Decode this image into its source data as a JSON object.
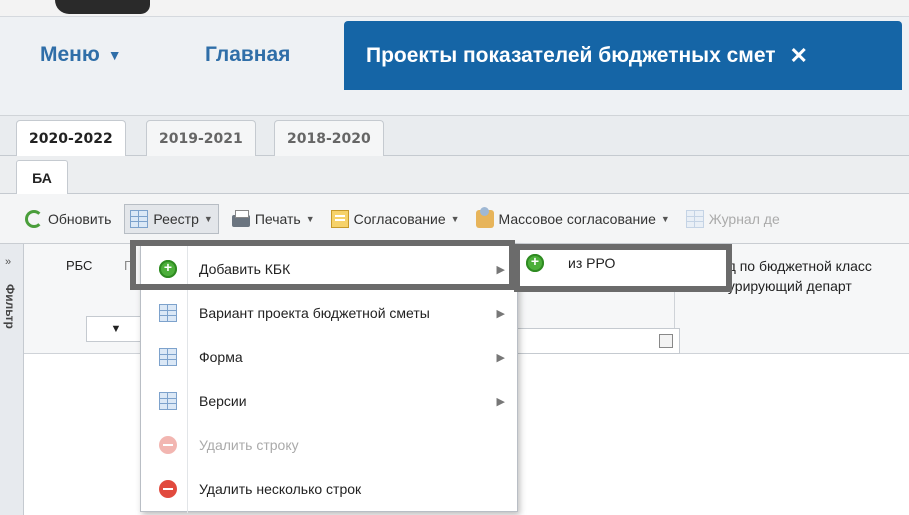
{
  "nav": {
    "menu_label": "Меню",
    "home_label": "Главная",
    "active_tab_title": "Проекты показателей бюджетных смет"
  },
  "year_tabs": [
    "2020-2022",
    "2019-2021",
    "2018-2020"
  ],
  "sub_tab": "БА",
  "toolbar": {
    "refresh": "Обновить",
    "registry": "Реестр",
    "print": "Печать",
    "approval": "Согласование",
    "mass_approval": "Массовое согласование",
    "journal": "Журнал де"
  },
  "grid": {
    "filter_label": "Фильтр",
    "col_rbs": "РБС",
    "col_g": "Г",
    "col_kod_line1": "Код по бюджетной класс",
    "col_kod_line2": "/ Курирующий департ"
  },
  "dropdown": {
    "items": [
      {
        "label": "Добавить КБК",
        "icon": "add-circle-icon",
        "submenu": true
      },
      {
        "label": "Вариант проекта бюджетной сметы",
        "icon": "grid-icon",
        "submenu": true
      },
      {
        "label": "Форма",
        "icon": "grid-icon",
        "submenu": true
      },
      {
        "label": "Версии",
        "icon": "grid-icon",
        "submenu": true
      },
      {
        "label": "Удалить строку",
        "icon": "delete-circle-icon",
        "disabled": true
      },
      {
        "label": "Удалить несколько строк",
        "icon": "delete-circle-icon"
      }
    ]
  },
  "submenu": {
    "item_label": "из РРО"
  },
  "colors": {
    "active_tab_bg": "#1565a6",
    "nav_link": "#2f6ea8",
    "highlight_frame": "#6b6b6b"
  }
}
